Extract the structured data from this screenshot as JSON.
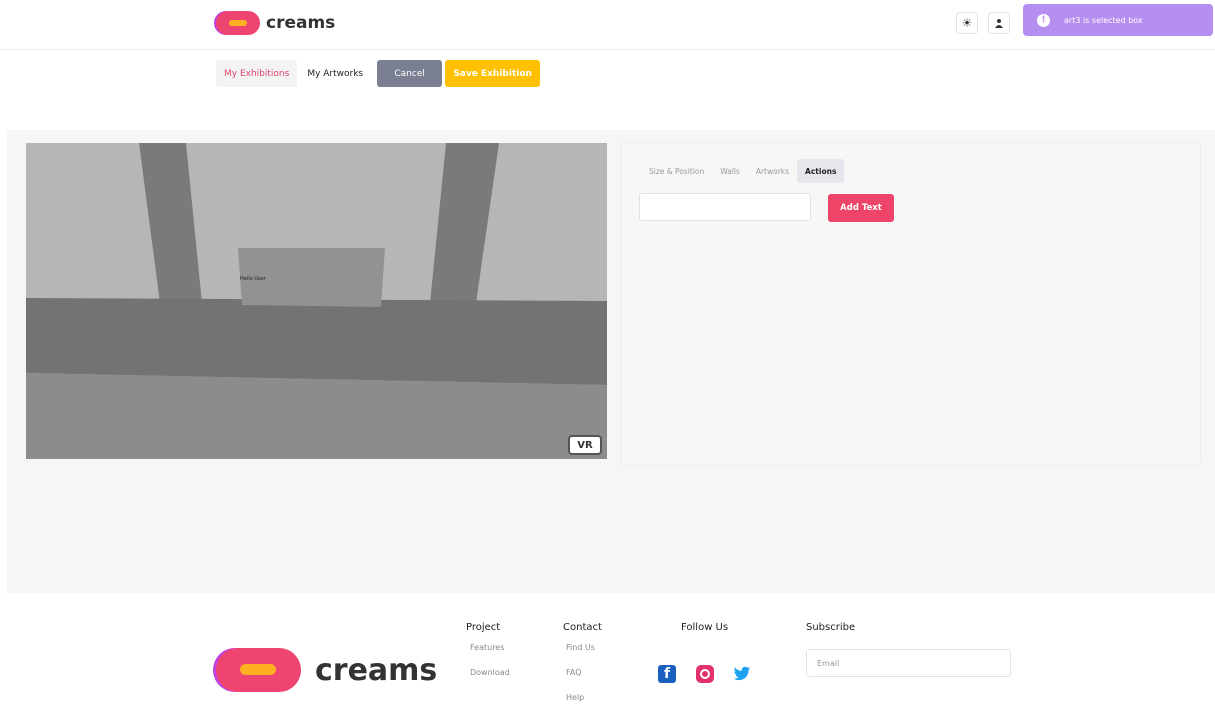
{
  "header": {
    "brand": "creams",
    "theme_icon": "sun-icon",
    "user_icon": "user-icon",
    "toast_message": "art3 is selected box",
    "toast_icon": "info-icon"
  },
  "subnav": {
    "my_exhibitions": "My Exhibitions",
    "my_artworks": "My Artworks",
    "cancel": "Cancel",
    "save_exhibition": "Save Exhibition"
  },
  "viewer": {
    "wall_text": "Hello User",
    "vr_label": "VR"
  },
  "panel": {
    "tabs": [
      "Size & Position",
      "Walls",
      "Artworks",
      "Actions"
    ],
    "active_tab": "Actions",
    "text_value": "",
    "add_text_label": "Add Text"
  },
  "footer": {
    "brand": "creams",
    "project": {
      "title": "Project",
      "links": [
        "Features",
        "Download"
      ]
    },
    "contact": {
      "title": "Contact",
      "links": [
        "Find Us",
        "FAQ",
        "Help"
      ]
    },
    "follow": {
      "title": "Follow Us",
      "icons": [
        "facebook-icon",
        "instagram-icon",
        "twitter-icon"
      ]
    },
    "subscribe": {
      "title": "Subscribe",
      "placeholder": "Email"
    }
  },
  "colors": {
    "accent": "#ee4467",
    "save": "#ffc000",
    "cancel": "#7a7f91",
    "toast": "#b58ff0"
  }
}
